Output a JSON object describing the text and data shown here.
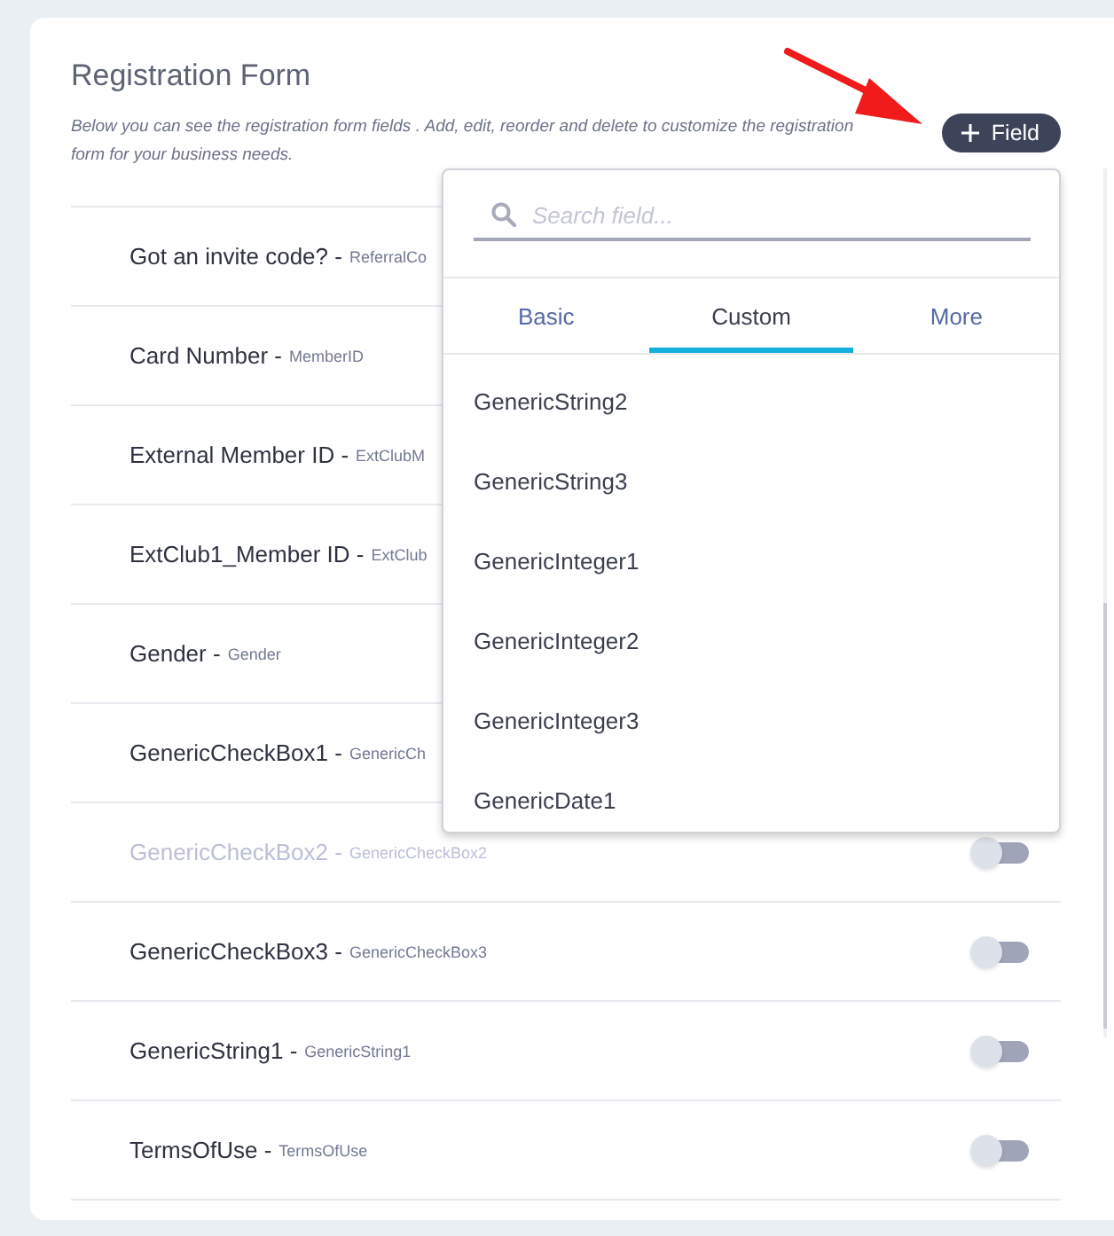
{
  "title": "Registration Form",
  "description": "Below you can see the registration form fields . Add, edit, reorder and delete to customize the registration form for your business needs.",
  "add_button": {
    "label": "Field"
  },
  "rows": [
    {
      "label": "Got an invite code? -",
      "field_id": "ReferralCo",
      "disabled": false
    },
    {
      "label": "Card Number -",
      "field_id": "MemberID",
      "disabled": false
    },
    {
      "label": "External Member ID -",
      "field_id": "ExtClubM",
      "disabled": false
    },
    {
      "label": "ExtClub1_Member ID -",
      "field_id": "ExtClub",
      "disabled": false
    },
    {
      "label": "Gender -",
      "field_id": "Gender",
      "disabled": false
    },
    {
      "label": "GenericCheckBox1 -",
      "field_id": "GenericCh",
      "disabled": false
    },
    {
      "label": "GenericCheckBox2 -",
      "field_id": "GenericCheckBox2",
      "disabled": true,
      "toggle": {
        "on": false
      }
    },
    {
      "label": "GenericCheckBox3 -",
      "field_id": "GenericCheckBox3",
      "disabled": false,
      "toggle": {
        "on": false
      }
    },
    {
      "label": "GenericString1 -",
      "field_id": "GenericString1",
      "disabled": false,
      "toggle": {
        "on": false
      }
    },
    {
      "label": "TermsOfUse -",
      "field_id": "TermsOfUse",
      "disabled": false,
      "toggle": {
        "on": false
      }
    }
  ],
  "dropdown": {
    "search": {
      "placeholder": "Search field..."
    },
    "tabs": [
      {
        "label": "Basic",
        "selected": false
      },
      {
        "label": "Custom",
        "selected": true
      },
      {
        "label": "More",
        "selected": false
      }
    ],
    "items": [
      "GenericString2",
      "GenericString3",
      "GenericInteger1",
      "GenericInteger2",
      "GenericInteger3",
      "GenericDate1"
    ]
  }
}
